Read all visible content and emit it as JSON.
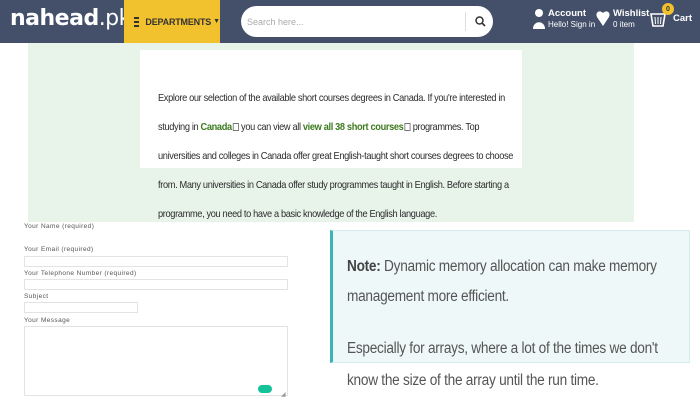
{
  "header": {
    "logo_main": "nahe",
    "logo_ad": "ad",
    "logo_tld": ".pk",
    "departments_label": "DEPARTMENTS",
    "search_placeholder": "Search here...",
    "account_title": "Account",
    "account_sub": "Hello! Sign in",
    "wishlist_title": "Wishlist",
    "wishlist_sub": "0 item",
    "cart_count": "0",
    "cart_label": "Cart"
  },
  "intro": {
    "t1": "Explore our selection of the available short courses degrees in Canada. If you're interested in studying in ",
    "link_canada": "Canada",
    "t2": " you can view all ",
    "link_courses": "view all 38 short courses",
    "t3": " programmes. Top universities and colleges in Canada offer great English-taught short courses degrees to choose from. Many universities in Canada offer study programmes taught in English. Before starting a programme, you need to have a basic knowledge of the English language."
  },
  "form": {
    "name_label": "Your Name (required)",
    "email_label": "Your Email (required)",
    "phone_label": "Your Telephone Number (required)",
    "subject_label": "Subject",
    "message_label": "Your Message"
  },
  "note": {
    "bold": "Note:",
    "p1": " Dynamic memory allocation can make memory management more efficient.",
    "p2": "Especially for arrays, where a lot of the times we don't know the size of the array until the run time."
  },
  "colors": {
    "header_bg": "#44506a",
    "accent_yellow": "#f2c12e",
    "link_green": "#3d7a1f",
    "note_border": "#3bb3b9"
  }
}
